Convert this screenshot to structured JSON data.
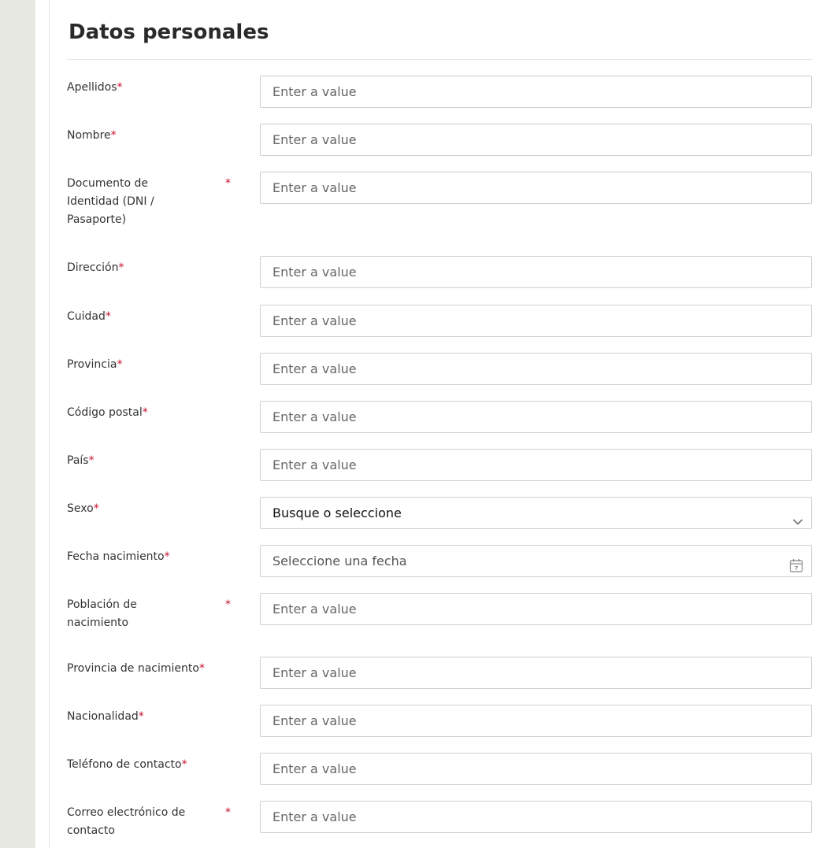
{
  "form": {
    "title": "Datos personales",
    "required_mark": "*",
    "input_placeholder": "Enter a value",
    "fields": {
      "apellidos": {
        "label": "Apellidos"
      },
      "nombre": {
        "label": "Nombre"
      },
      "documento": {
        "label": "Documento de Identidad (DNI / Pasaporte)"
      },
      "direccion": {
        "label": "Dirección"
      },
      "cuidad": {
        "label": "Cuidad"
      },
      "provincia": {
        "label": "Provincia"
      },
      "codigo_postal": {
        "label": "Código postal"
      },
      "pais": {
        "label": "País"
      },
      "sexo": {
        "label": "Sexo",
        "value": "Busque o seleccione"
      },
      "fecha_nacimiento": {
        "label": "Fecha nacimiento",
        "placeholder": "Seleccione una fecha"
      },
      "poblacion_nacimiento": {
        "label": "Población de nacimiento"
      },
      "provincia_nacimiento": {
        "label": "Provincia de nacimiento"
      },
      "nacionalidad": {
        "label": "Nacionalidad"
      },
      "telefono": {
        "label": "Teléfono de contacto"
      },
      "correo": {
        "label": "Correo electrónico de contacto"
      }
    }
  },
  "colors": {
    "required": "#c8102e",
    "sidebar": "#e8e8e3",
    "border": "#cfcfcf"
  }
}
